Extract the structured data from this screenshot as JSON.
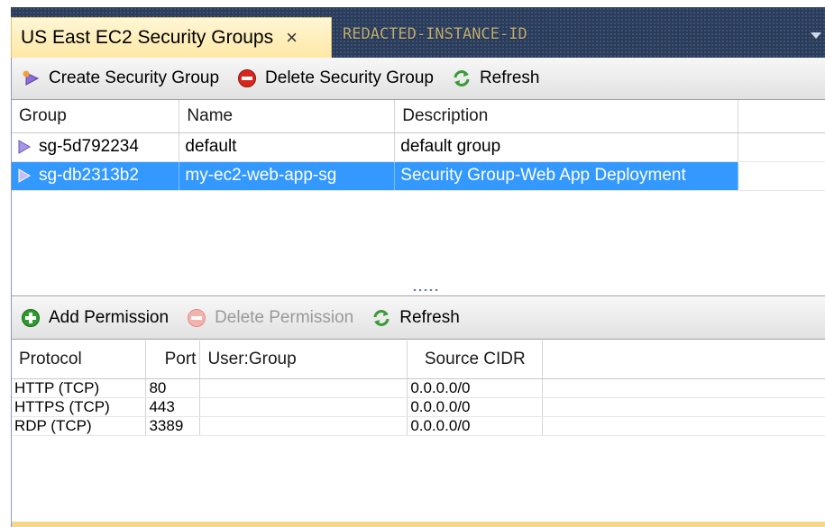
{
  "tabs": {
    "active_label": "US East EC2 Security Groups",
    "close_glyph": "×",
    "inactive_label": "REDACTED-INSTANCE-ID"
  },
  "toolbar_groups": {
    "create_label": "Create Security Group",
    "delete_label": "Delete Security Group",
    "refresh_label": "Refresh"
  },
  "groups_table": {
    "headers": [
      "Group",
      "Name",
      "Description"
    ],
    "rows": [
      {
        "group": "sg-5d792234",
        "name": "default",
        "description": "default group",
        "selected": false
      },
      {
        "group": "sg-db2313b2",
        "name": "my-ec2-web-app-sg",
        "description": "Security Group-Web App Deployment",
        "selected": true
      }
    ]
  },
  "toolbar_permissions": {
    "add_label": "Add Permission",
    "delete_label": "Delete Permission",
    "refresh_label": "Refresh"
  },
  "permissions_table": {
    "headers": [
      "Protocol",
      "Port",
      "User:Group",
      "Source CIDR"
    ],
    "rows": [
      {
        "protocol": "HTTP (TCP)",
        "port": "80",
        "user_group": "",
        "source_cidr": "0.0.0.0/0"
      },
      {
        "protocol": "HTTPS (TCP)",
        "port": "443",
        "user_group": "",
        "source_cidr": "0.0.0.0/0"
      },
      {
        "protocol": "RDP (TCP)",
        "port": "3389",
        "user_group": "",
        "source_cidr": "0.0.0.0/0"
      }
    ]
  },
  "icons": {
    "create": "security-group-add-icon",
    "delete": "delete-red-circle-icon",
    "refresh": "refresh-green-arrows-icon",
    "group_row": "security-group-shield-icon",
    "add_permission": "add-green-circle-icon"
  },
  "colors": {
    "selection": "#3399ff",
    "frame": "#2b3c59",
    "active_tab": "#ffe8a6"
  }
}
